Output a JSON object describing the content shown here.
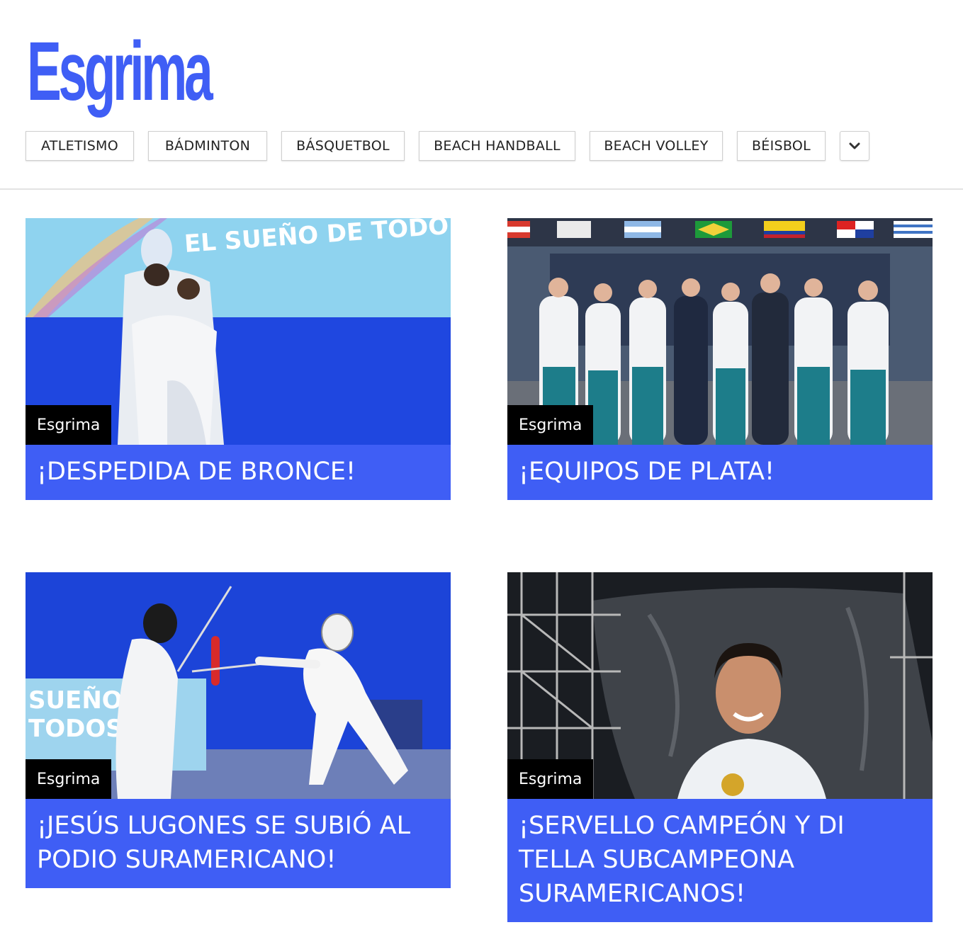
{
  "site": {
    "title": "Esgrima"
  },
  "nav": {
    "items": [
      {
        "label": "ATLETISMO"
      },
      {
        "label": "BÁDMINTON"
      },
      {
        "label": "BÁSQUETBOL"
      },
      {
        "label": "BEACH HANDBALL"
      },
      {
        "label": "BEACH VOLLEY"
      },
      {
        "label": "BÉISBOL"
      }
    ],
    "more_icon": "chevron-down-icon"
  },
  "articles": [
    {
      "category": "Esgrima",
      "headline": "¡DESPEDIDA DE BRONCE!"
    },
    {
      "category": "Esgrima",
      "headline": "¡EQUIPOS DE PLATA!"
    },
    {
      "category": "Esgrima",
      "headline": "¡JESÚS LUGONES SE SUBIÓ AL PODIO SURAMERICANO!"
    },
    {
      "category": "Esgrima",
      "headline": "¡SERVELLO CAMPEÓN Y DI TELLA SUBCAMPEONA SURAMERICANOS!"
    }
  ],
  "image_text": {
    "banner_1": "EL SUEÑO DE TODO",
    "banner_3a": "SUEÑO",
    "banner_3b": "TODOS"
  },
  "colors": {
    "accent": "#3f5ef5",
    "category_bg": "#000000"
  }
}
